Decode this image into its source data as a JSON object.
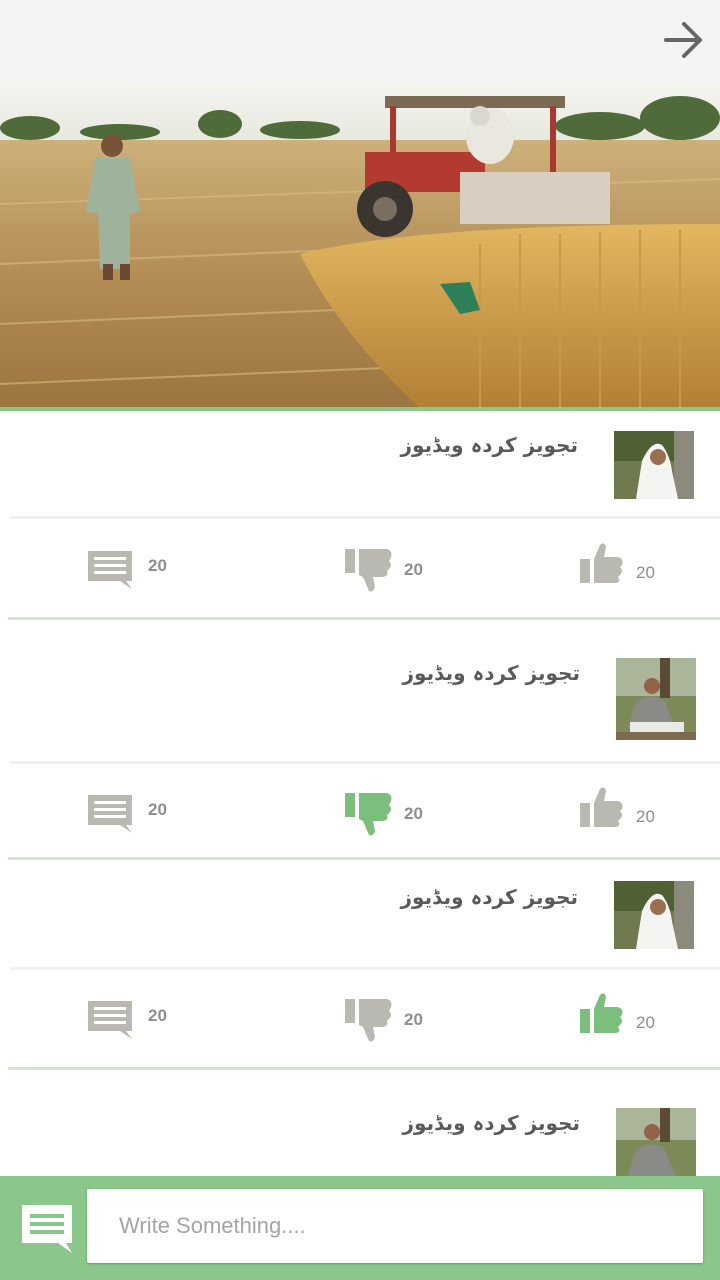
{
  "header": {
    "back_icon": "arrow-right-icon"
  },
  "hero": {
    "description_icon": "wheat-harvest-photo"
  },
  "colors": {
    "accent": "#8bc68a",
    "active_green": "#7cbe7c",
    "inactive_gray": "#b9b9b1"
  },
  "feed": {
    "items": [
      {
        "title": "تجویز کردہ ویڈیوز",
        "comments": "20",
        "dislikes": "20",
        "likes": "20",
        "liked": false,
        "disliked": false
      },
      {
        "title": "تجویز کردہ ویڈیوز",
        "comments": "20",
        "dislikes": "20",
        "likes": "20",
        "liked": false,
        "disliked": true
      },
      {
        "title": "تجویز کردہ ویڈیوز",
        "comments": "20",
        "dislikes": "20",
        "likes": "20",
        "liked": true,
        "disliked": false
      },
      {
        "title": "تجویز کردہ ویڈیوز"
      }
    ]
  },
  "composer": {
    "placeholder": "Write Something....",
    "chat_icon": "chat-bubble-icon"
  }
}
